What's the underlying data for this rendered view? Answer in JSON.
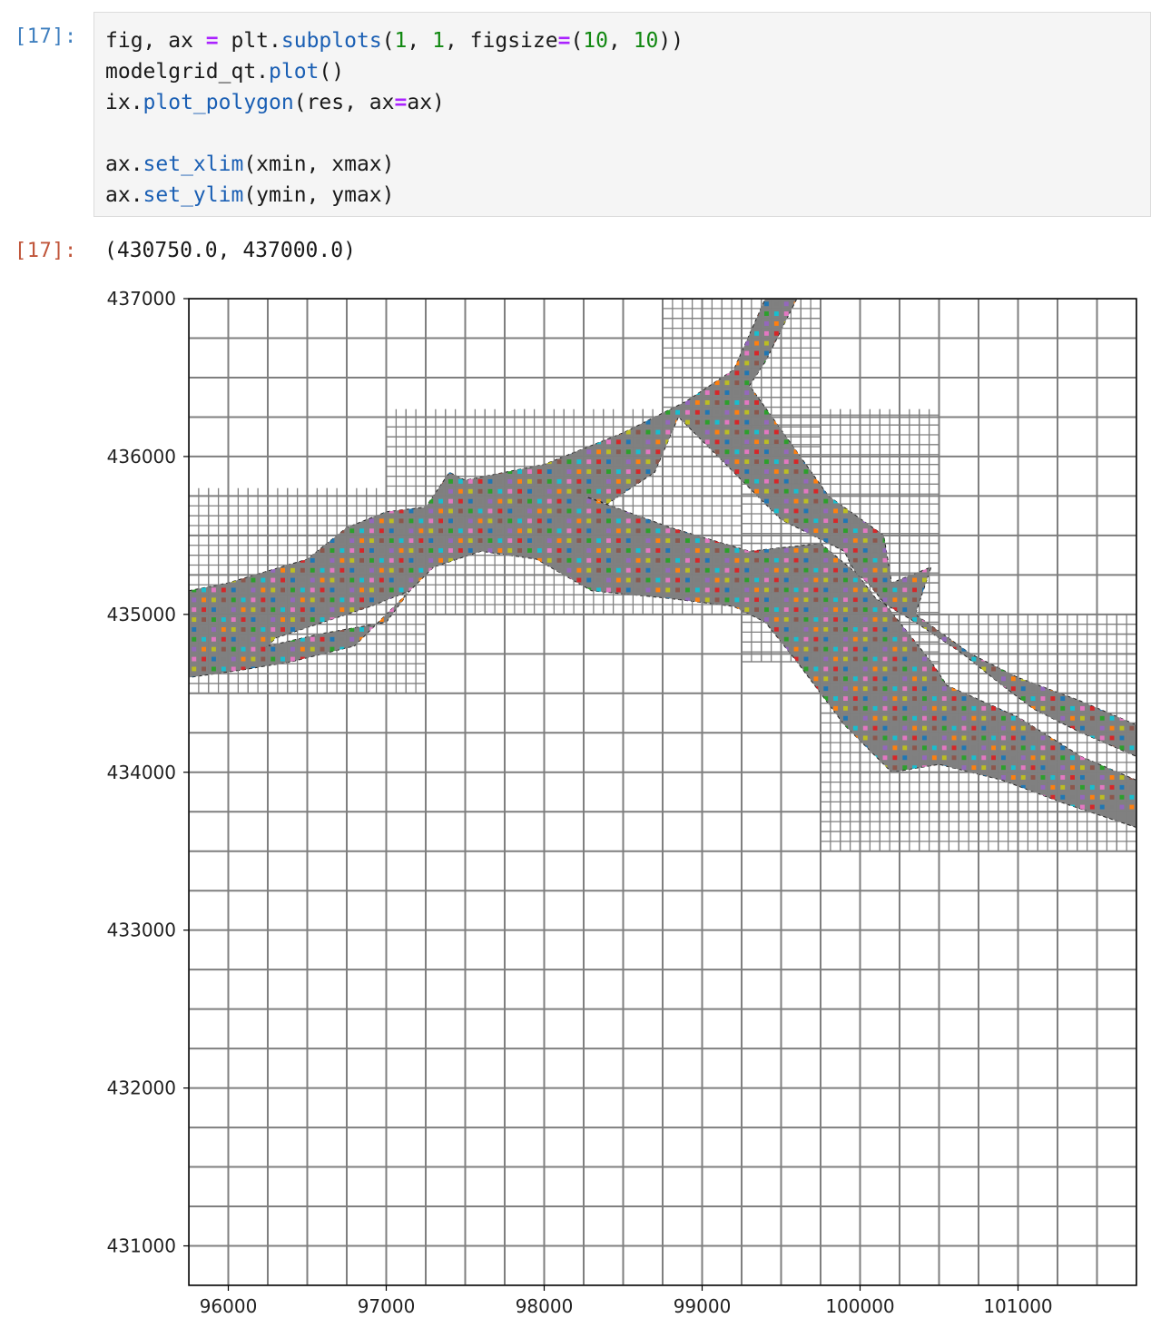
{
  "cell": {
    "in_prompt": "[17]:",
    "out_prompt": "[17]:",
    "code_lines": [
      [
        [
          "fig, ax ",
          ""
        ],
        [
          "=",
          "op"
        ],
        [
          " plt.",
          ""
        ],
        [
          "subplots",
          "fn"
        ],
        [
          "(",
          ""
        ],
        [
          "1",
          "num"
        ],
        [
          ", ",
          ""
        ],
        [
          "1",
          "num"
        ],
        [
          ", figsize",
          ""
        ],
        [
          "=",
          "op"
        ],
        [
          "(",
          ""
        ],
        [
          "10",
          "num"
        ],
        [
          ", ",
          ""
        ],
        [
          "10",
          "num"
        ],
        [
          "))",
          ""
        ]
      ],
      [
        [
          "modelgrid_qt.",
          ""
        ],
        [
          "plot",
          "fn"
        ],
        [
          "()",
          ""
        ]
      ],
      [
        [
          "ix.",
          ""
        ],
        [
          "plot_polygon",
          "fn"
        ],
        [
          "(res, ax",
          ""
        ],
        [
          "=",
          "op"
        ],
        [
          "ax)",
          ""
        ]
      ],
      [
        [
          "",
          ""
        ]
      ],
      [
        [
          "ax.",
          ""
        ],
        [
          "set_xlim",
          "fn"
        ],
        [
          "(xmin, xmax)",
          ""
        ]
      ],
      [
        [
          "ax.",
          ""
        ],
        [
          "set_ylim",
          "fn"
        ],
        [
          "(ymin, ymax)",
          ""
        ]
      ]
    ],
    "output_text": "(430750.0, 437000.0)"
  },
  "colors": {
    "grid_line": "#7f7f7f",
    "polygon_fill": "#808080",
    "cell_palette": [
      "#1f77b4",
      "#ff7f0e",
      "#2ca02c",
      "#d62728",
      "#9467bd",
      "#8c564b",
      "#e377c2",
      "#7f7f7f",
      "#bcbd22",
      "#17becf"
    ]
  },
  "chart_data": {
    "type": "other",
    "description_type": "quadtree grid with rasterized river polygon",
    "xlim": [
      95750,
      101750
    ],
    "ylim": [
      430750,
      437000
    ],
    "xticks": [
      96000,
      97000,
      98000,
      99000,
      100000,
      101000
    ],
    "yticks": [
      431000,
      432000,
      433000,
      434000,
      435000,
      436000,
      437000
    ],
    "xtick_labels": [
      "96000",
      "97000",
      "98000",
      "99000",
      "100000",
      "101000"
    ],
    "ytick_labels": [
      "431000",
      "432000",
      "433000",
      "434000",
      "435000",
      "436000",
      "437000"
    ],
    "base_cell_size": 250,
    "river_polygon": [
      [
        95750,
        435150
      ],
      [
        96000,
        435200
      ],
      [
        96500,
        435350
      ],
      [
        96750,
        435550
      ],
      [
        97000,
        435650
      ],
      [
        97250,
        435680
      ],
      [
        97400,
        435900
      ],
      [
        97500,
        435850
      ],
      [
        98000,
        435950
      ],
      [
        98500,
        436150
      ],
      [
        98900,
        436350
      ],
      [
        99200,
        436550
      ],
      [
        99400,
        437000
      ],
      [
        99600,
        437000
      ],
      [
        99400,
        436600
      ],
      [
        99300,
        436450
      ],
      [
        99550,
        436100
      ],
      [
        99800,
        435750
      ],
      [
        100150,
        435500
      ],
      [
        100200,
        435200
      ],
      [
        100450,
        435300
      ],
      [
        100350,
        435000
      ],
      [
        100700,
        434750
      ],
      [
        101000,
        434600
      ],
      [
        101400,
        434450
      ],
      [
        101750,
        434300
      ],
      [
        101750,
        434100
      ],
      [
        101400,
        434250
      ],
      [
        101100,
        434400
      ],
      [
        100900,
        434550
      ],
      [
        100650,
        434750
      ],
      [
        100350,
        434950
      ],
      [
        100100,
        435100
      ],
      [
        99950,
        435300
      ],
      [
        99900,
        435400
      ],
      [
        99500,
        435600
      ],
      [
        99200,
        435900
      ],
      [
        98850,
        436250
      ],
      [
        98700,
        435900
      ],
      [
        98400,
        435700
      ],
      [
        98250,
        435750
      ],
      [
        98800,
        435550
      ],
      [
        99300,
        435400
      ],
      [
        99750,
        435450
      ],
      [
        100050,
        435200
      ],
      [
        100450,
        434700
      ],
      [
        100550,
        434550
      ],
      [
        101000,
        434350
      ],
      [
        101400,
        434100
      ],
      [
        101750,
        433950
      ],
      [
        101750,
        433650
      ],
      [
        101300,
        433800
      ],
      [
        100900,
        433950
      ],
      [
        100500,
        434050
      ],
      [
        100200,
        434000
      ],
      [
        100050,
        434150
      ],
      [
        99900,
        434300
      ],
      [
        99600,
        434700
      ],
      [
        99400,
        434950
      ],
      [
        99200,
        435050
      ],
      [
        98800,
        435100
      ],
      [
        98300,
        435150
      ],
      [
        97950,
        435350
      ],
      [
        97600,
        435400
      ],
      [
        97300,
        435300
      ],
      [
        97200,
        435200
      ],
      [
        97000,
        435000
      ],
      [
        96800,
        434800
      ],
      [
        96400,
        434700
      ],
      [
        96100,
        434650
      ],
      [
        95750,
        434600
      ]
    ],
    "river_holes": [
      [
        [
          96250,
          434800
        ],
        [
          96600,
          434880
        ],
        [
          97000,
          434950
        ],
        [
          97150,
          435150
        ],
        [
          96900,
          435050
        ],
        [
          96600,
          434950
        ],
        [
          96300,
          434850
        ]
      ]
    ],
    "refined_bands": [
      {
        "xmin": 95750,
        "xmax": 97250,
        "ymin": 434500,
        "ymax": 435800,
        "level": 2
      },
      {
        "xmin": 97000,
        "xmax": 99250,
        "ymin": 435000,
        "ymax": 436300,
        "level": 2
      },
      {
        "xmin": 98750,
        "xmax": 99750,
        "ymin": 436000,
        "ymax": 437000,
        "level": 2
      },
      {
        "xmin": 99250,
        "xmax": 100500,
        "ymin": 434700,
        "ymax": 436300,
        "level": 2
      },
      {
        "xmin": 99750,
        "xmax": 101750,
        "ymin": 433500,
        "ymax": 435000,
        "level": 2
      }
    ]
  }
}
